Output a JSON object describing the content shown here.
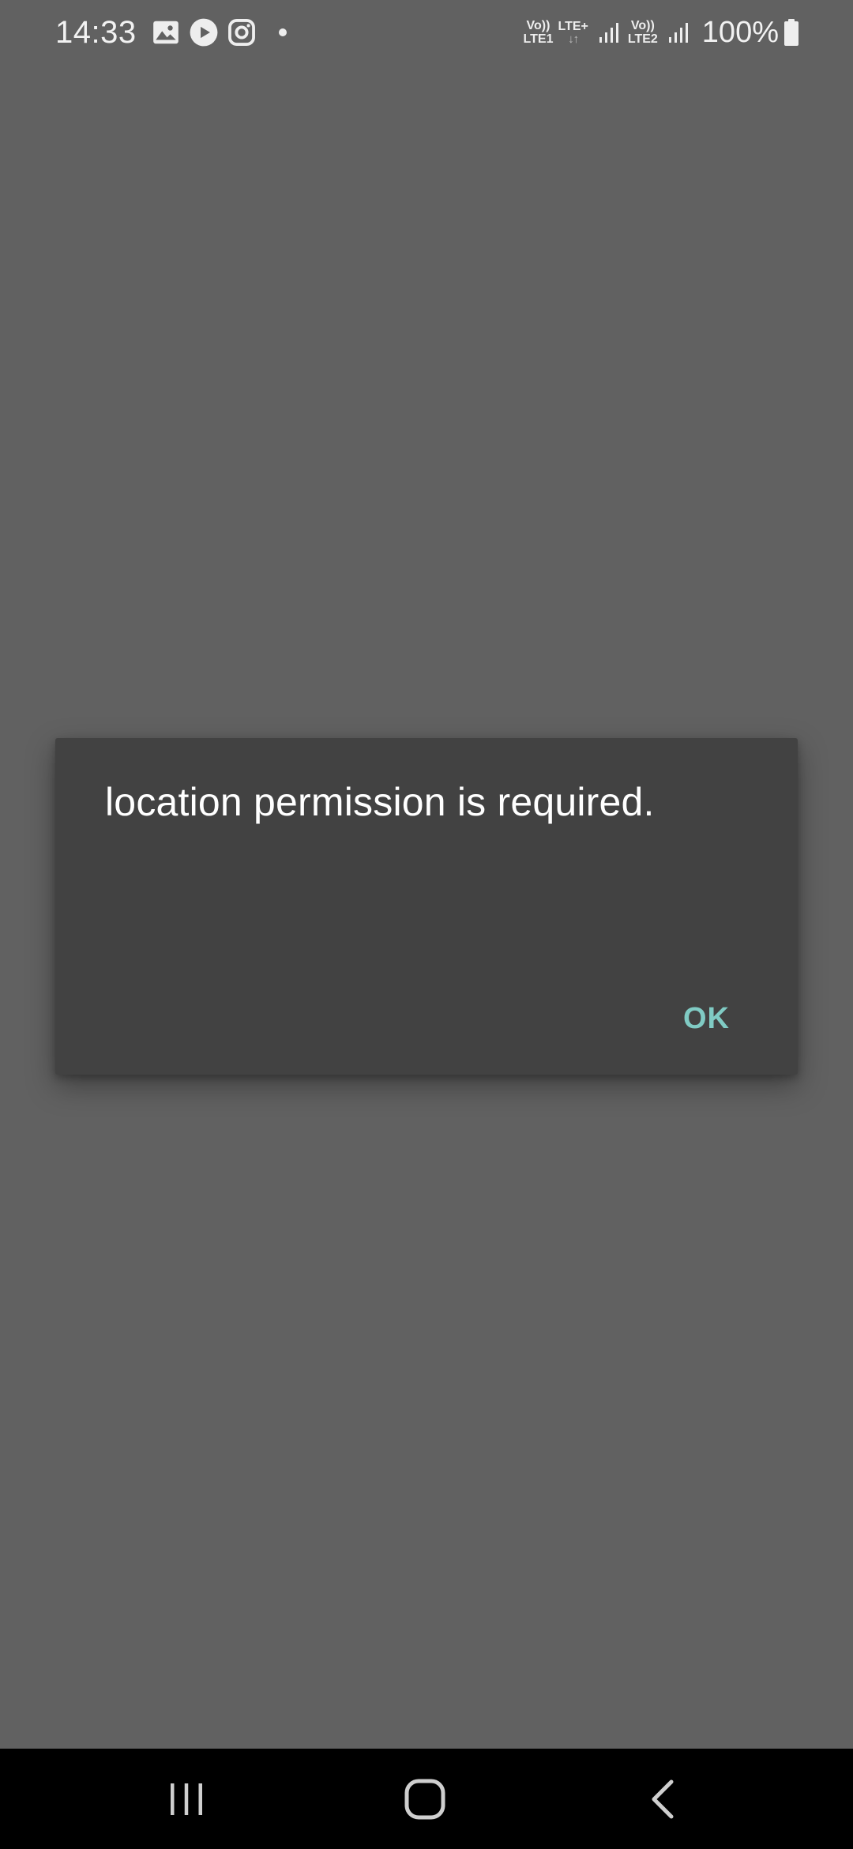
{
  "status_bar": {
    "time": "14:33",
    "notification_icons": [
      "gallery-icon",
      "youtube-icon",
      "instagram-icon",
      "more-notifications-dot"
    ],
    "sim1": {
      "top": "Vo))",
      "bottom": "LTE1"
    },
    "data": {
      "top": "LTE+",
      "bottom": "↓↑"
    },
    "sim2": {
      "top": "Vo))",
      "bottom": "LTE2"
    },
    "battery": "100%"
  },
  "dialog": {
    "message": "location permission is required.",
    "ok_label": "OK",
    "accent_color": "#80cbc4"
  },
  "nav_bar": {
    "icons": [
      "recents-icon",
      "home-icon",
      "back-icon"
    ]
  },
  "colors": {
    "scrim": "#616161",
    "dialog_bg": "#424242",
    "nav_bg": "#000000"
  }
}
